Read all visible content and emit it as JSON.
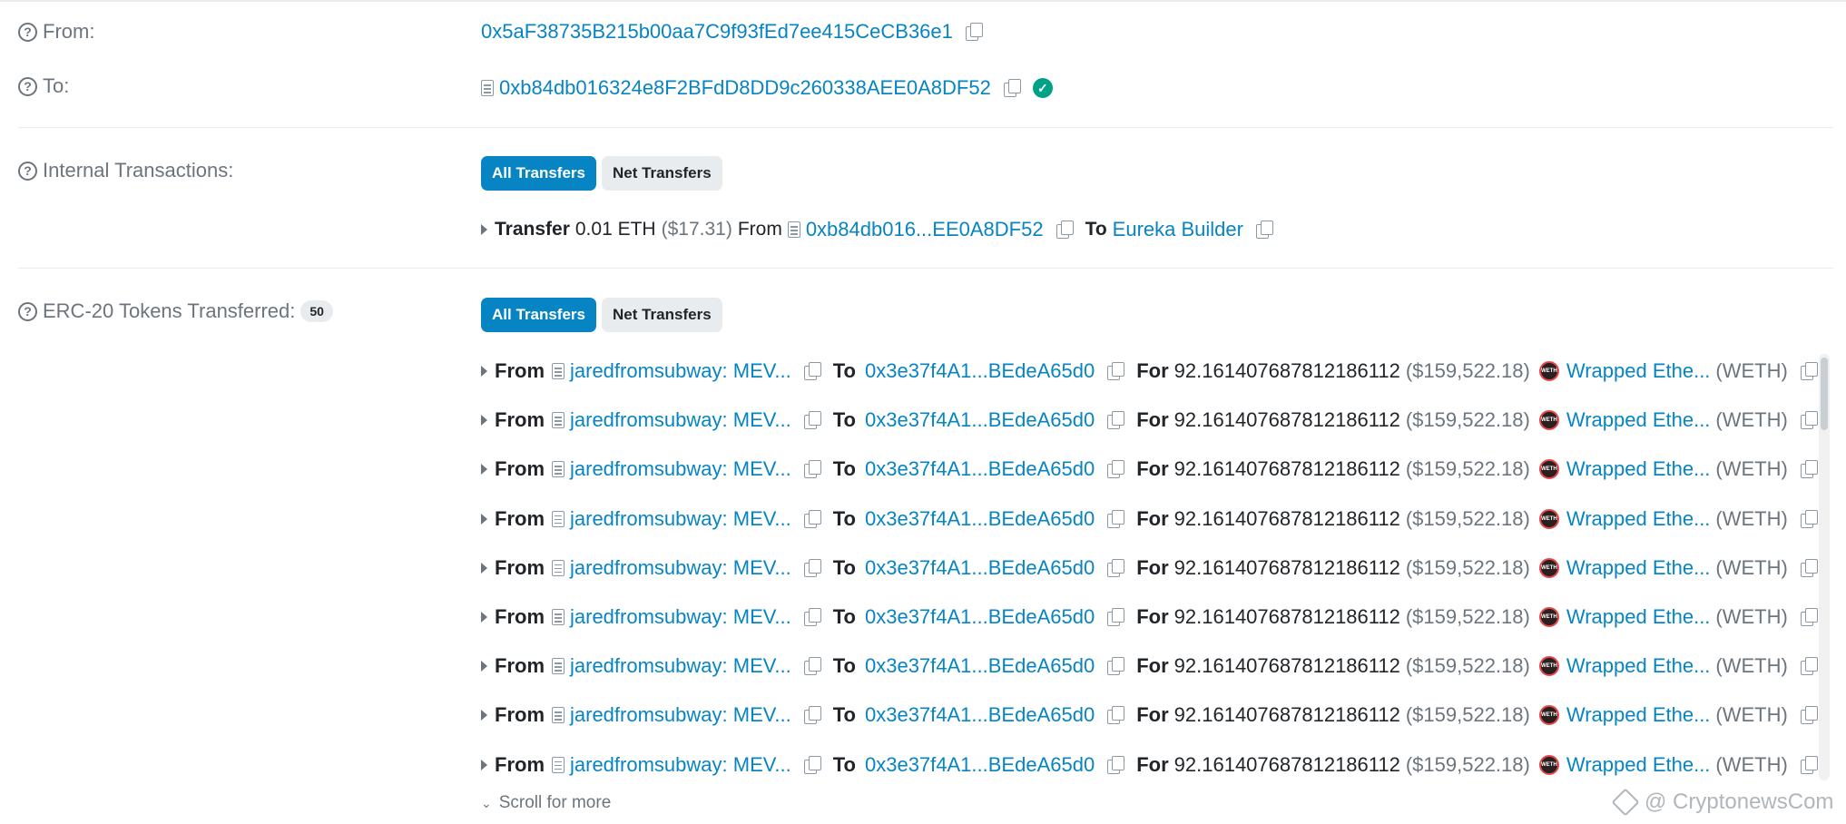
{
  "from": {
    "label": "From:",
    "address": "0x5aF38735B215b00aa7C9f93fEd7ee415CeCB36e1"
  },
  "to": {
    "label": "To:",
    "address": "0xb84db016324e8F2BFdD8DD9c260338AEE0A8DF52"
  },
  "internal": {
    "label": "Internal Transactions:",
    "tab_all": "All Transfers",
    "tab_net": "Net Transfers",
    "transfer": {
      "word": "Transfer",
      "amount": "0.01 ETH",
      "usd": "($17.31)",
      "from_word": "From",
      "from_addr": "0xb84db016...EE0A8DF52",
      "to_word": "To",
      "to_addr": "Eureka Builder"
    }
  },
  "erc20": {
    "label": "ERC-20 Tokens Transferred:",
    "count": "50",
    "tab_all": "All Transfers",
    "tab_net": "Net Transfers",
    "rows": [
      {
        "from_word": "From",
        "from": "jaredfromsubway: MEV...",
        "to_word": "To",
        "to": "0x3e37f4A1...BEdeA65d0",
        "for_word": "For",
        "amount": "92.161407687812186112",
        "usd": "($159,522.18)",
        "token": "Wrapped Ethe...",
        "symbol": "(WETH)"
      },
      {
        "from_word": "From",
        "from": "jaredfromsubway: MEV...",
        "to_word": "To",
        "to": "0x3e37f4A1...BEdeA65d0",
        "for_word": "For",
        "amount": "92.161407687812186112",
        "usd": "($159,522.18)",
        "token": "Wrapped Ethe...",
        "symbol": "(WETH)"
      },
      {
        "from_word": "From",
        "from": "jaredfromsubway: MEV...",
        "to_word": "To",
        "to": "0x3e37f4A1...BEdeA65d0",
        "for_word": "For",
        "amount": "92.161407687812186112",
        "usd": "($159,522.18)",
        "token": "Wrapped Ethe...",
        "symbol": "(WETH)"
      },
      {
        "from_word": "From",
        "from": "jaredfromsubway: MEV...",
        "to_word": "To",
        "to": "0x3e37f4A1...BEdeA65d0",
        "for_word": "For",
        "amount": "92.161407687812186112",
        "usd": "($159,522.18)",
        "token": "Wrapped Ethe...",
        "symbol": "(WETH)"
      },
      {
        "from_word": "From",
        "from": "jaredfromsubway: MEV...",
        "to_word": "To",
        "to": "0x3e37f4A1...BEdeA65d0",
        "for_word": "For",
        "amount": "92.161407687812186112",
        "usd": "($159,522.18)",
        "token": "Wrapped Ethe...",
        "symbol": "(WETH)"
      },
      {
        "from_word": "From",
        "from": "jaredfromsubway: MEV...",
        "to_word": "To",
        "to": "0x3e37f4A1...BEdeA65d0",
        "for_word": "For",
        "amount": "92.161407687812186112",
        "usd": "($159,522.18)",
        "token": "Wrapped Ethe...",
        "symbol": "(WETH)"
      },
      {
        "from_word": "From",
        "from": "jaredfromsubway: MEV...",
        "to_word": "To",
        "to": "0x3e37f4A1...BEdeA65d0",
        "for_word": "For",
        "amount": "92.161407687812186112",
        "usd": "($159,522.18)",
        "token": "Wrapped Ethe...",
        "symbol": "(WETH)"
      },
      {
        "from_word": "From",
        "from": "jaredfromsubway: MEV...",
        "to_word": "To",
        "to": "0x3e37f4A1...BEdeA65d0",
        "for_word": "For",
        "amount": "92.161407687812186112",
        "usd": "($159,522.18)",
        "token": "Wrapped Ethe...",
        "symbol": "(WETH)"
      },
      {
        "from_word": "From",
        "from": "jaredfromsubway: MEV...",
        "to_word": "To",
        "to": "0x3e37f4A1...BEdeA65d0",
        "for_word": "For",
        "amount": "92.161407687812186112",
        "usd": "($159,522.18)",
        "token": "Wrapped Ethe...",
        "symbol": "(WETH)"
      }
    ],
    "scroll_more": "Scroll for more"
  },
  "watermark": "@ CryptonewsCom",
  "colors": {
    "link": "#0784c3",
    "primary": "#0784c3",
    "muted": "#6c757d",
    "verified": "#00a186"
  }
}
